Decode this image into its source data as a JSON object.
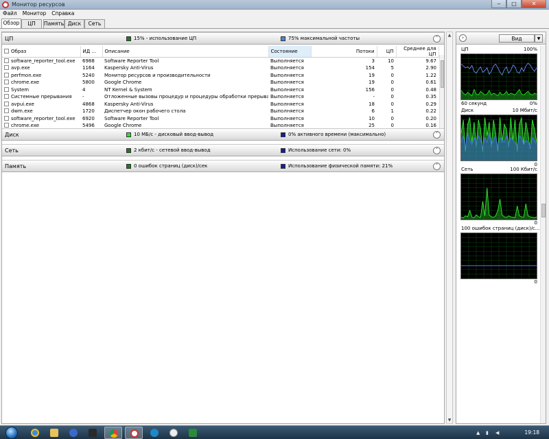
{
  "window": {
    "title": "Монитор ресурсов",
    "minimize": "‒",
    "maximize": "□",
    "close": "✕"
  },
  "menu": [
    "Файл",
    "Монитор",
    "Справка"
  ],
  "tabs": [
    "Обзор",
    "ЦП",
    "Память",
    "Диск",
    "Сеть"
  ],
  "cpu": {
    "name": "ЦП",
    "usage_text": "15% - использование ЦП",
    "freq_text": "75% максимальной частоты",
    "usage_color": "#1f7a1f",
    "freq_color": "#4a86d6",
    "columns": {
      "image": "Образ",
      "pid": "ИД ...",
      "description": "Описание",
      "status": "Состояние",
      "threads": "Потоки",
      "cpu": "ЦП",
      "avg": "Среднее для ЦП"
    },
    "rows": [
      {
        "image": "software_reporter_tool.exe",
        "pid": "6988",
        "description": "Software Reporter Tool",
        "status": "Выполняется",
        "threads": "3",
        "cpu": "10",
        "avg": "9.67"
      },
      {
        "image": "avp.exe",
        "pid": "1164",
        "description": "Kaspersky Anti-Virus",
        "status": "Выполняется",
        "threads": "154",
        "cpu": "5",
        "avg": "2.90"
      },
      {
        "image": "perfmon.exe",
        "pid": "5240",
        "description": "Монитор ресурсов и производительности",
        "status": "Выполняется",
        "threads": "19",
        "cpu": "0",
        "avg": "1.22"
      },
      {
        "image": "chrome.exe",
        "pid": "5800",
        "description": "Google Chrome",
        "status": "Выполняется",
        "threads": "19",
        "cpu": "0",
        "avg": "0.61"
      },
      {
        "image": "System",
        "pid": "4",
        "description": "NT Kernel & System",
        "status": "Выполняется",
        "threads": "156",
        "cpu": "0",
        "avg": "0.48"
      },
      {
        "image": "Системные прерывания",
        "pid": "-",
        "description": "Отложенные вызовы процедур и процедуры обработки прерываний",
        "status": "Выполняется",
        "threads": "-",
        "cpu": "0",
        "avg": "0.35"
      },
      {
        "image": "avpui.exe",
        "pid": "4868",
        "description": "Kaspersky Anti-Virus",
        "status": "Выполняется",
        "threads": "18",
        "cpu": "0",
        "avg": "0.29"
      },
      {
        "image": "dwm.exe",
        "pid": "1720",
        "description": "Диспетчер окон рабочего стола",
        "status": "Выполняется",
        "threads": "6",
        "cpu": "1",
        "avg": "0.22"
      },
      {
        "image": "software_reporter_tool.exe",
        "pid": "6920",
        "description": "Software Reporter Tool",
        "status": "Выполняется",
        "threads": "10",
        "cpu": "0",
        "avg": "0.20"
      },
      {
        "image": "chrome.exe",
        "pid": "5496",
        "description": "Google Chrome",
        "status": "Выполняется",
        "threads": "25",
        "cpu": "0",
        "avg": "0.16"
      }
    ]
  },
  "disk": {
    "name": "Диск",
    "io_text": "10 МБ/с - дисковый ввод-вывод",
    "active_text": "0% активного времени (максимально)",
    "io_color": "#33dd33",
    "active_color": "#1a1aa0"
  },
  "net": {
    "name": "Сеть",
    "io_text": "2 кбит/с - сетевой ввод-вывод",
    "usage_text": "Использование сети: 0%",
    "io_color": "#1f7a1f",
    "usage_color": "#1a1aa0"
  },
  "memory": {
    "name": "Память",
    "faults_text": "0 ошибок страниц (диск)/сек",
    "usage_text": "Использование физической памяти: 21%",
    "faults_color": "#1f7a1f",
    "usage_color": "#1a1aa0"
  },
  "side": {
    "view_label": "Вид",
    "graphs": [
      {
        "label": "ЦП",
        "max": "100%",
        "footer_left": "60 секунд",
        "footer_right": "0%"
      },
      {
        "label": "Диск",
        "max": "10 Мбит/с",
        "footer_left": "",
        "footer_right": "0"
      },
      {
        "label": "Сеть",
        "max": "100 Кбит/с",
        "footer_left": "",
        "footer_right": "0"
      },
      {
        "label": "100 ошибок страниц (диск)/с...",
        "max": "",
        "footer_left": "",
        "footer_right": "0"
      }
    ],
    "series": {
      "cpu_blue": [
        78,
        74,
        70,
        72,
        68,
        75,
        62,
        58,
        66,
        72,
        60,
        64,
        70,
        56,
        62,
        74,
        78,
        70,
        60,
        54,
        66,
        72,
        58,
        64,
        76,
        72,
        60,
        58,
        70,
        62,
        74,
        80,
        76,
        68,
        62,
        70
      ],
      "cpu_green": [
        20,
        14,
        10,
        16,
        12,
        8,
        22,
        12,
        10,
        18,
        14,
        10,
        12,
        20,
        10,
        14,
        12,
        8,
        16,
        10,
        12,
        18,
        10,
        14,
        12,
        10,
        16,
        22,
        12,
        10,
        14,
        18,
        12,
        10,
        14,
        12
      ],
      "disk_green": [
        60,
        90,
        20,
        80,
        95,
        40,
        85,
        30,
        90,
        70,
        20,
        95,
        55,
        85,
        30,
        90,
        60,
        20,
        95,
        40,
        80,
        70,
        30,
        95,
        45,
        90,
        20,
        80,
        95,
        35,
        85,
        60,
        25,
        90,
        70,
        40
      ],
      "disk_blue": [
        40,
        55,
        30,
        60,
        45,
        35,
        50,
        40,
        55,
        45,
        30,
        50,
        40,
        60,
        35,
        45,
        55,
        30,
        50,
        45,
        40,
        55,
        35,
        50,
        45,
        40,
        30,
        55,
        50,
        35,
        45,
        40,
        30,
        50,
        45,
        35
      ],
      "net_green": [
        5,
        4,
        8,
        6,
        20,
        5,
        4,
        10,
        6,
        5,
        40,
        8,
        70,
        10,
        6,
        5,
        8,
        20,
        45,
        10,
        6,
        5,
        8,
        6,
        5,
        4,
        30,
        8,
        6,
        5,
        35,
        8,
        6,
        5,
        4,
        6
      ],
      "mem_blue": [
        28,
        28,
        28,
        28,
        28,
        28,
        28,
        28,
        28,
        28,
        28,
        28,
        28,
        28,
        28,
        28,
        28,
        28,
        28,
        28,
        28,
        28,
        28,
        28,
        28,
        28,
        28,
        28,
        28,
        28,
        28,
        28,
        28,
        28,
        28,
        28
      ]
    }
  },
  "taskbar": {
    "time": "19:18"
  }
}
